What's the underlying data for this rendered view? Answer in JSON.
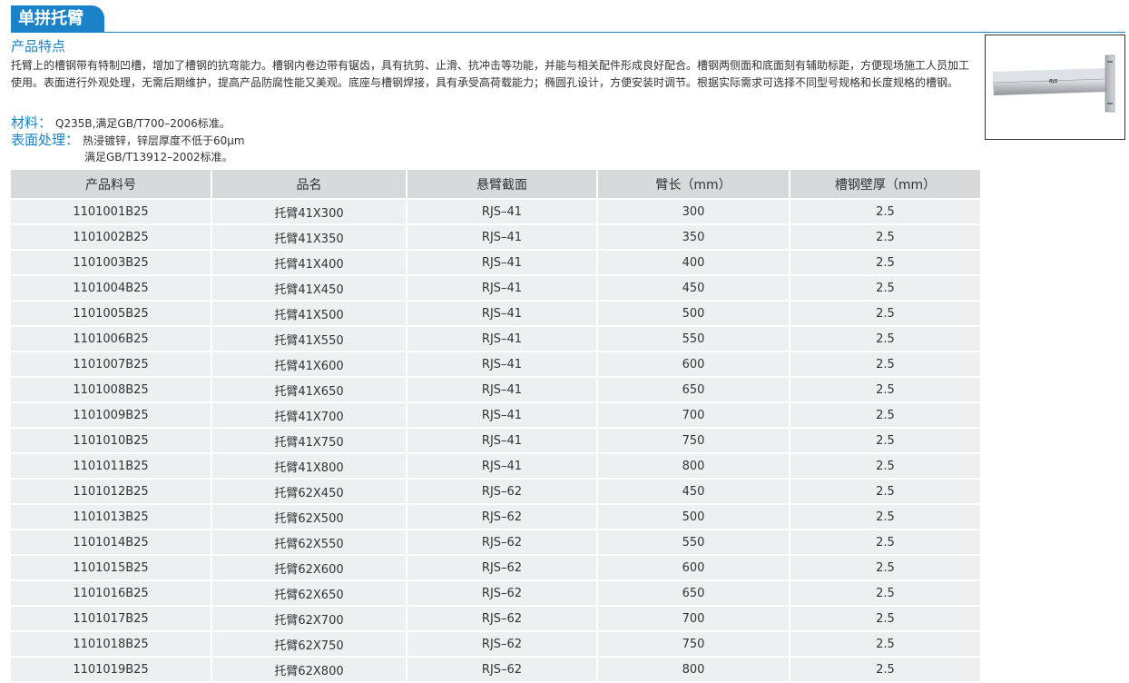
{
  "header": {
    "title": "单拼托臂"
  },
  "features": {
    "heading": "产品特点",
    "text": "托臂上的槽钢带有特制凹槽，增加了槽钢的抗弯能力。槽钢内卷边带有锯齿，具有抗剪、止滑、抗冲击等功能，并能与相关配件形成良好配合。槽钢两侧面和底面刻有辅助标距，方便现场施工人员加工使用。表面进行外观处理，无需后期维护，提高产品防腐性能又美观。底座与槽钢焊接，具有承受高荷载能力；椭圆孔设计，方便安装时调节。根据实际需求可选择不同型号规格和长度规格的槽钢。"
  },
  "material": {
    "label": "材料：",
    "value": "Q235B,满足GB/T700–2006标准。"
  },
  "surface": {
    "label": "表面处理：",
    "value": "热浸镀锌，锌层厚度不低于60μm",
    "value2": "满足GB/T13912–2002标准。"
  },
  "product_image": {
    "marking": "RJS"
  },
  "table": {
    "headers": [
      "产品料号",
      "品名",
      "悬臂截面",
      "臂长（mm）",
      "槽钢壁厚（mm）"
    ],
    "rows": [
      [
        "1101001B25",
        "托臂41X300",
        "RJS–41",
        "300",
        "2.5"
      ],
      [
        "1101002B25",
        "托臂41X350",
        "RJS–41",
        "350",
        "2.5"
      ],
      [
        "1101003B25",
        "托臂41X400",
        "RJS–41",
        "400",
        "2.5"
      ],
      [
        "1101004B25",
        "托臂41X450",
        "RJS–41",
        "450",
        "2.5"
      ],
      [
        "1101005B25",
        "托臂41X500",
        "RJS–41",
        "500",
        "2.5"
      ],
      [
        "1101006B25",
        "托臂41X550",
        "RJS–41",
        "550",
        "2.5"
      ],
      [
        "1101007B25",
        "托臂41X600",
        "RJS–41",
        "600",
        "2.5"
      ],
      [
        "1101008B25",
        "托臂41X650",
        "RJS–41",
        "650",
        "2.5"
      ],
      [
        "1101009B25",
        "托臂41X700",
        "RJS–41",
        "700",
        "2.5"
      ],
      [
        "1101010B25",
        "托臂41X750",
        "RJS–41",
        "750",
        "2.5"
      ],
      [
        "1101011B25",
        "托臂41X800",
        "RJS–41",
        "800",
        "2.5"
      ],
      [
        "1101012B25",
        "托臂62X450",
        "RJS–62",
        "450",
        "2.5"
      ],
      [
        "1101013B25",
        "托臂62X500",
        "RJS–62",
        "500",
        "2.5"
      ],
      [
        "1101014B25",
        "托臂62X550",
        "RJS–62",
        "550",
        "2.5"
      ],
      [
        "1101015B25",
        "托臂62X600",
        "RJS–62",
        "600",
        "2.5"
      ],
      [
        "1101016B25",
        "托臂62X650",
        "RJS–62",
        "650",
        "2.5"
      ],
      [
        "1101017B25",
        "托臂62X700",
        "RJS–62",
        "700",
        "2.5"
      ],
      [
        "1101018B25",
        "托臂62X750",
        "RJS–62",
        "750",
        "2.5"
      ],
      [
        "1101019B25",
        "托臂62X800",
        "RJS–62",
        "800",
        "2.5"
      ]
    ]
  }
}
